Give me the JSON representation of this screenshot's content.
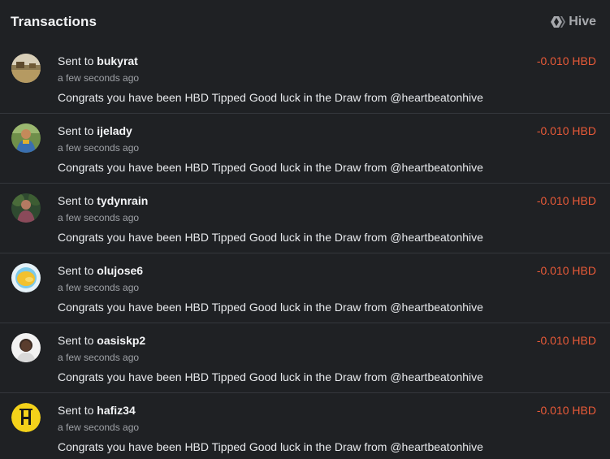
{
  "header": {
    "title": "Transactions",
    "brand_label": "Hive",
    "brand_icon": "hive-logo-icon"
  },
  "colors": {
    "background": "#1f2124",
    "amount_negative": "#e95a38",
    "divider": "#34373c"
  },
  "transactions": [
    {
      "prefix": "Sent to",
      "user": "bukyrat",
      "time": "a few seconds ago",
      "memo": "Congrats you have been HBD Tipped Good luck in the Draw from @heartbeatonhive",
      "amount": "-0.010 HBD",
      "avatar_icon": "landscape-photo-avatar"
    },
    {
      "prefix": "Sent to",
      "user": "ijelady",
      "time": "a few seconds ago",
      "memo": "Congrats you have been HBD Tipped Good luck in the Draw from @heartbeatonhive",
      "amount": "-0.010 HBD",
      "avatar_icon": "person-photo-avatar"
    },
    {
      "prefix": "Sent to",
      "user": "tydynrain",
      "time": "a few seconds ago",
      "memo": "Congrats you have been HBD Tipped Good luck in the Draw from @heartbeatonhive",
      "amount": "-0.010 HBD",
      "avatar_icon": "person-outdoor-photo-avatar"
    },
    {
      "prefix": "Sent to",
      "user": "olujose6",
      "time": "a few seconds ago",
      "memo": "Congrats you have been HBD Tipped Good luck in the Draw from @heartbeatonhive",
      "amount": "-0.010 HBD",
      "avatar_icon": "yellow-blob-avatar"
    },
    {
      "prefix": "Sent to",
      "user": "oasiskp2",
      "time": "a few seconds ago",
      "memo": "Congrats you have been HBD Tipped Good luck in the Draw from @heartbeatonhive",
      "amount": "-0.010 HBD",
      "avatar_icon": "portrait-photo-avatar"
    },
    {
      "prefix": "Sent to",
      "user": "hafiz34",
      "time": "a few seconds ago",
      "memo": "Congrats you have been HBD Tipped Good luck in the Draw from @heartbeatonhive",
      "amount": "-0.010 HBD",
      "avatar_icon": "yellow-h-logo-avatar"
    }
  ]
}
